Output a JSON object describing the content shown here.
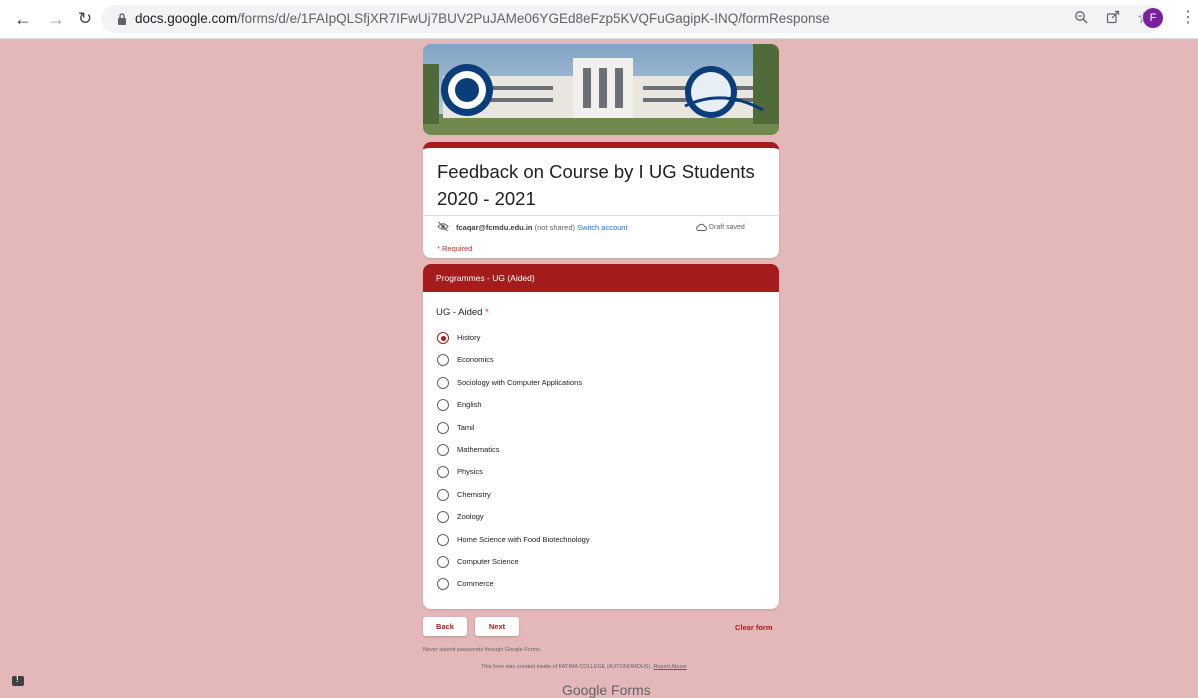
{
  "browser": {
    "url_host": "docs.google.com",
    "url_path": "/forms/d/e/1FAIpQLSfjXR7IFwUj7BUV2PuJAMe06YGEd8eFzp5KVQFuGagipK-INQ/formResponse",
    "profile_initial": "F"
  },
  "form": {
    "title_line1": "Feedback on Course by I UG Students",
    "title_line2": "2020 - 2021",
    "account_email": "fcaqar@fcmdu.edu.in",
    "not_shared": " (not shared) ",
    "switch_account": "Switch account",
    "draft_status": "Draft saved",
    "required_note": "* Required"
  },
  "section": {
    "header": "Programmes - UG (Aided)",
    "question": "UG - Aided",
    "required_star": " *",
    "options": [
      "History",
      "Economics",
      "Sociology with Computer Applications",
      "English",
      "Tamil",
      "Mathematics",
      "Physics",
      "Chemistry",
      "Zoology",
      "Home Science with Food Biotechnology",
      "Computer Science",
      "Commerce"
    ],
    "selected": "History"
  },
  "nav": {
    "back": "Back",
    "next": "Next",
    "clear": "Clear form"
  },
  "footer": {
    "password_note": "Never submit passwords through Google Forms.",
    "created_prefix": "This form was created inside of FATIMA COLLEGE (AUTONOMOUS). ",
    "report_abuse": "Report Abuse",
    "brand": "Google Forms"
  },
  "colors": {
    "accent": "#a51c1c",
    "background": "#e4b8b8"
  }
}
